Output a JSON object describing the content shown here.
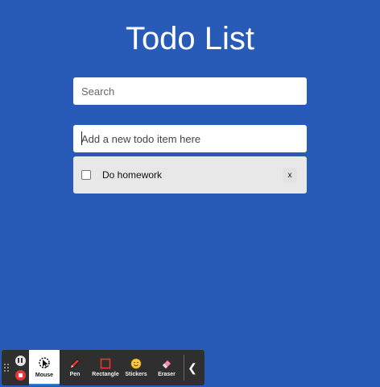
{
  "app": {
    "title": "Todo List"
  },
  "search": {
    "placeholder": "Search",
    "value": ""
  },
  "new_todo": {
    "placeholder": "Add a new todo item here",
    "value": ""
  },
  "todos": [
    {
      "text": "Do homework",
      "completed": false,
      "delete_label": "x"
    }
  ],
  "toolbar": {
    "tools": [
      {
        "label": "Mouse",
        "icon": "mouse-icon",
        "active": true
      },
      {
        "label": "Pen",
        "icon": "pen-icon",
        "active": false
      },
      {
        "label": "Rectangle",
        "icon": "rectangle-icon",
        "active": false
      },
      {
        "label": "Stickers",
        "icon": "sticker-icon",
        "active": false
      },
      {
        "label": "Eraser",
        "icon": "eraser-icon",
        "active": false
      }
    ]
  },
  "colors": {
    "background": "#275bb7",
    "todo_item_bg": "#e8e8e8",
    "toolbar_bg": "#2f2f2f",
    "stop": "#e53935"
  }
}
